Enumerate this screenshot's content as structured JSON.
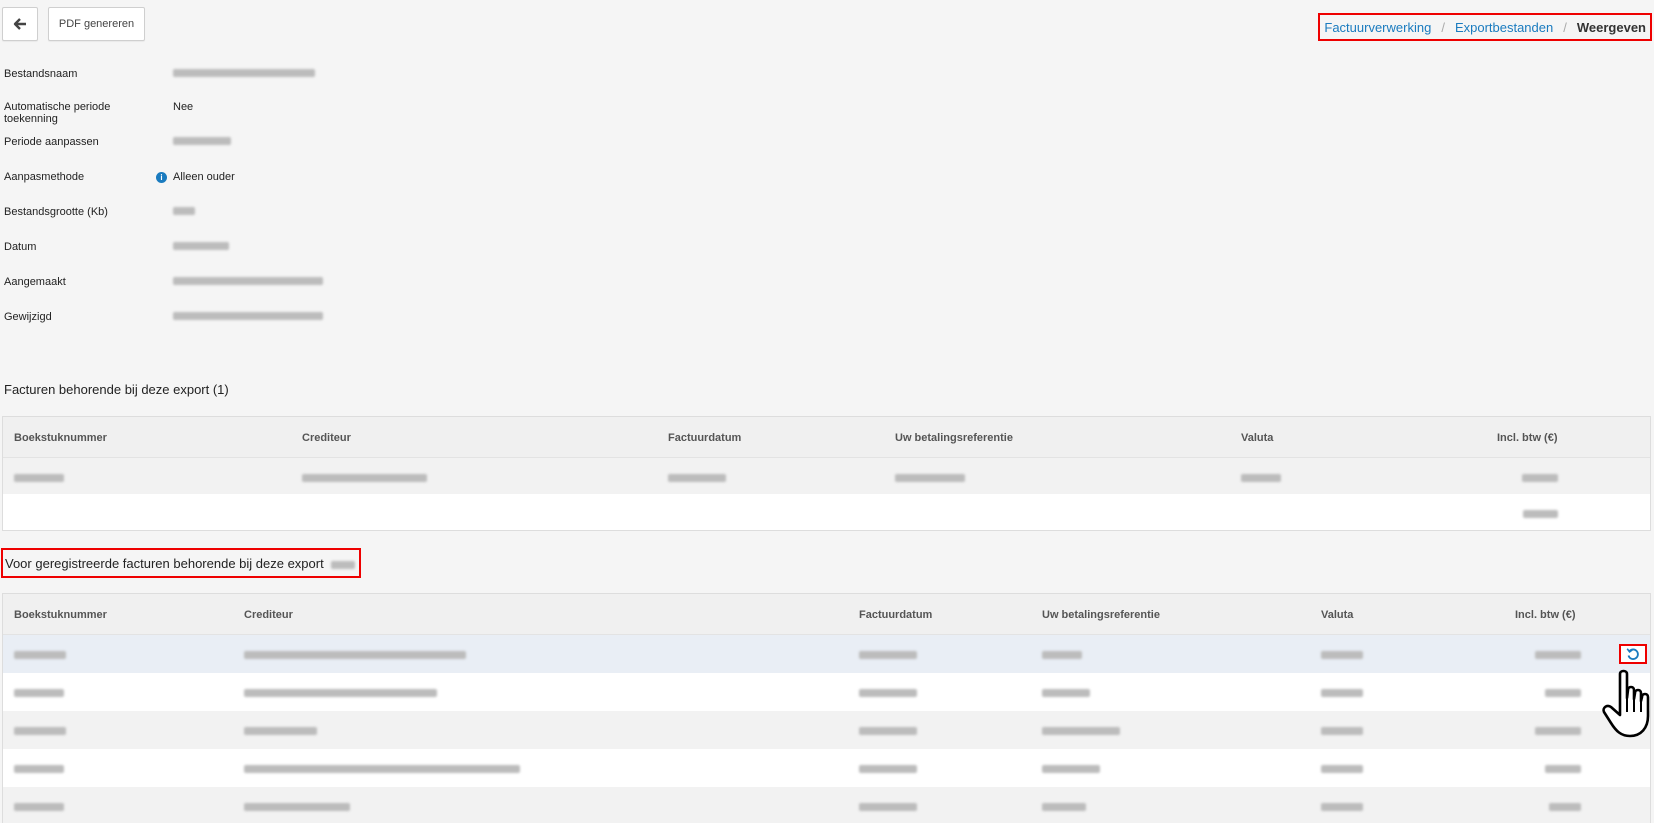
{
  "toolbar": {
    "back_icon": "arrow-left-icon",
    "pdf_label": "PDF genereren"
  },
  "breadcrumb": {
    "item1": "Factuurverwerking",
    "item2": "Exportbestanden",
    "current": "Weergeven",
    "separator": "/"
  },
  "details": {
    "filename_label": "Bestandsnaam",
    "auto_period_label": "Automatische periode toekenning",
    "auto_period_value": "Nee",
    "period_label": "Periode aanpassen",
    "method_label": "Aanpasmethode",
    "method_info_icon": "info-icon",
    "method_value": "Alleen ouder",
    "size_label": "Bestandsgrootte (Kb)",
    "date_label": "Datum",
    "created_label": "Aangemaakt",
    "modified_label": "Gewijzigd"
  },
  "invoices_section": {
    "title": "Facturen behorende bij deze export (1)",
    "columns": [
      "Boekstuknummer",
      "Crediteur",
      "Factuurdatum",
      "Uw betalingsreferentie",
      "Valuta",
      "Incl. btw (€)"
    ]
  },
  "preregistered_section": {
    "title": "Voor geregistreerde facturen behorende bij deze export",
    "columns": [
      "Boekstuknummer",
      "Crediteur",
      "Factuurdatum",
      "Uw betalingsreferentie",
      "Valuta",
      "Incl. btw (€)"
    ],
    "row_action_icon": "refresh-icon"
  },
  "colors": {
    "link": "#1a7bbf",
    "highlight_border": "#ee0000"
  }
}
